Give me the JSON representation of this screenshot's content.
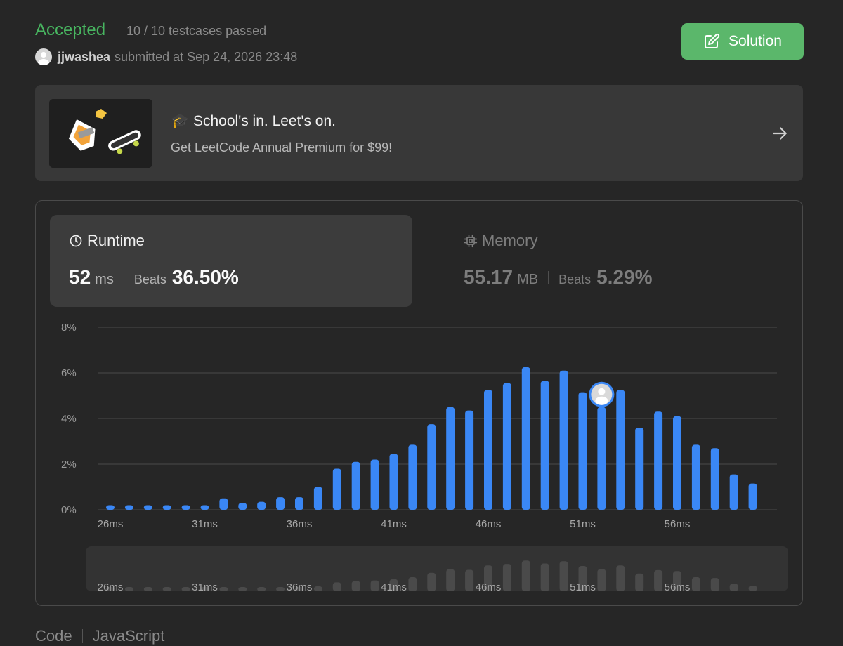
{
  "submission": {
    "status": "Accepted",
    "testcases": "10 / 10 testcases passed",
    "user": "jjwashea",
    "submitted_text": "submitted at Sep 24, 2026 23:48",
    "solution_label": "Solution"
  },
  "promo": {
    "title": "School's in. Leet's on.",
    "subtitle": "Get LeetCode Annual Premium for $99!"
  },
  "runtime": {
    "label": "Runtime",
    "value": "52",
    "unit": "ms",
    "beats_label": "Beats",
    "beats": "36.50%"
  },
  "memory": {
    "label": "Memory",
    "value": "55.17",
    "unit": "MB",
    "beats_label": "Beats",
    "beats": "5.29%"
  },
  "chart_data": {
    "type": "bar",
    "x": [
      26,
      27,
      28,
      29,
      30,
      31,
      32,
      33,
      34,
      35,
      36,
      37,
      38,
      39,
      40,
      41,
      42,
      43,
      44,
      45,
      46,
      47,
      48,
      49,
      50,
      51,
      52,
      53,
      54,
      55,
      56,
      57,
      58,
      59,
      60
    ],
    "values": [
      0.2,
      0.2,
      0.2,
      0.2,
      0.2,
      0.2,
      0.5,
      0.3,
      0.35,
      0.55,
      0.55,
      1.0,
      1.8,
      2.1,
      2.2,
      2.45,
      2.85,
      3.75,
      4.5,
      4.35,
      5.25,
      5.55,
      6.25,
      5.65,
      6.1,
      5.15,
      4.5,
      5.25,
      3.6,
      4.3,
      4.1,
      2.85,
      2.7,
      1.55,
      1.15
    ],
    "ylim": [
      0,
      8
    ],
    "yticks": [
      "0%",
      "2%",
      "4%",
      "6%",
      "8%"
    ],
    "xticks": [
      "26ms",
      "31ms",
      "36ms",
      "41ms",
      "46ms",
      "51ms",
      "56ms"
    ],
    "xtick_values": [
      26,
      31,
      36,
      41,
      46,
      51,
      56
    ],
    "highlight_x": 52,
    "grid": true,
    "bar_color": "#3a87f5",
    "minimap_bar_color": "#4a4a4a"
  },
  "code": {
    "label": "Code",
    "language": "JavaScript"
  },
  "colors": {
    "accepted": "#48b560",
    "solution_button": "#5bb76b",
    "background": "#262626"
  }
}
